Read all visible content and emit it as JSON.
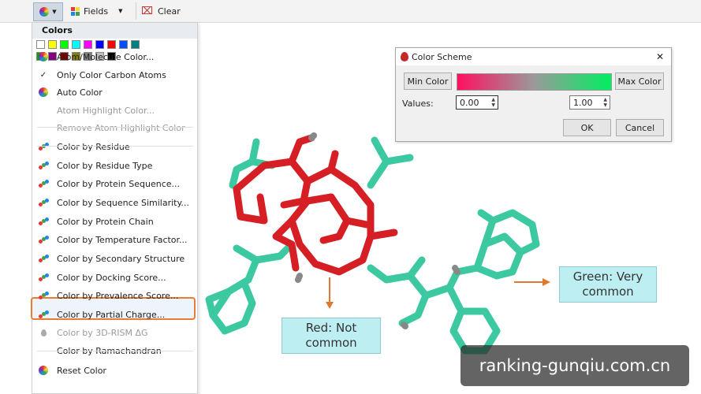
{
  "toolbar": {
    "color_icon": "color-wheel-icon",
    "fields_label": "Fields",
    "clear_label": "Clear"
  },
  "menu": {
    "header": "Colors",
    "swatches": [
      "#ffffff",
      "#ffff00",
      "#00ff00",
      "#00ffff",
      "#ff00ff",
      "#0000ff",
      "#ff0000",
      "#0050ff",
      "#008080",
      "#00a000",
      "#800080",
      "#800000",
      "#808000",
      "#808080",
      "#c0c0c0",
      "#000000"
    ],
    "items": [
      {
        "label": "Atom/Molecule Color...",
        "icon": "color-wheel-icon",
        "enabled": true
      },
      {
        "label": "Only Color Carbon Atoms",
        "icon": "checkmark-icon",
        "enabled": true
      },
      {
        "label": "Auto Color",
        "icon": "color-wheel-icon",
        "enabled": true
      },
      {
        "label": "Atom Highlight Color...",
        "icon": "",
        "enabled": false
      },
      {
        "label": "Remove Atom Highlight Color",
        "icon": "",
        "enabled": false
      },
      {
        "label": "Color by Residue",
        "icon": "molecule-icon",
        "enabled": true
      },
      {
        "label": "Color by Residue Type",
        "icon": "molecule-icon",
        "enabled": true
      },
      {
        "label": "Color by Protein Sequence...",
        "icon": "molecule-icon",
        "enabled": true
      },
      {
        "label": "Color by Sequence Similarity...",
        "icon": "molecule-icon",
        "enabled": true
      },
      {
        "label": "Color by Protein Chain",
        "icon": "molecule-icon",
        "enabled": true
      },
      {
        "label": "Color by Temperature Factor...",
        "icon": "molecule-icon",
        "enabled": true
      },
      {
        "label": "Color by Secondary Structure",
        "icon": "molecule-icon",
        "enabled": true
      },
      {
        "label": "Color by Docking Score...",
        "icon": "molecule-icon",
        "enabled": true
      },
      {
        "label": "Color by Prevalence Score...",
        "icon": "molecule-icon",
        "enabled": true
      },
      {
        "label": "Color by Partial Charge...",
        "icon": "molecule-icon",
        "enabled": true
      },
      {
        "label": "Color by 3D-RISM ΔG",
        "icon": "droplet-icon",
        "enabled": false
      },
      {
        "label": "Color by Ramachandran",
        "icon": "",
        "enabled": true
      },
      {
        "label": "Reset Color",
        "icon": "color-wheel-icon",
        "enabled": true
      }
    ]
  },
  "dialog": {
    "title": "Color Scheme",
    "min_color_label": "Min Color",
    "max_color_label": "Max Color",
    "values_label": "Values:",
    "min_value": "0.00",
    "max_value": "1.00",
    "ok_label": "OK",
    "cancel_label": "Cancel",
    "gradient_colors": [
      "#ff1060",
      "#9a9a9a",
      "#00ee60"
    ]
  },
  "callouts": {
    "red_text": "Red: Not\ncommon",
    "green_text": "Green: Very\ncommon"
  },
  "watermark": "ranking-gunqiu.com.cn",
  "colors": {
    "highlight_border": "#e97d33",
    "molecule_red": "#d61f24",
    "molecule_teal": "#3cc9a2",
    "callout_bg": "#bdeef2"
  }
}
